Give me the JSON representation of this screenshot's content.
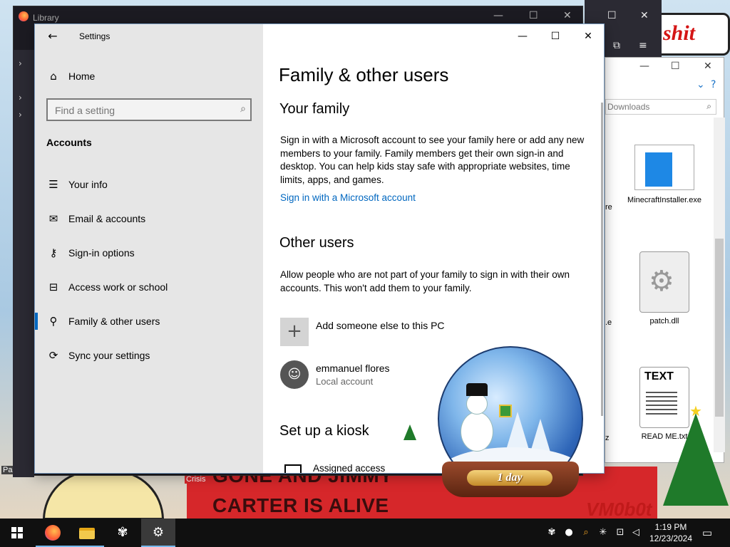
{
  "background": {
    "library_title": "Library",
    "explorer_search_placeholder": "Downloads",
    "explorer_files": [
      {
        "name": "MinecraftInstaller.exe",
        "icon": "exe-icon"
      },
      {
        "name": "patch.dll",
        "icon": "dll-icon"
      },
      {
        "name": "READ ME.txt",
        "icon": "txt-icon",
        "icon_text": "TEXT"
      }
    ],
    "explorer_partial_labels": [
      "re",
      ".e",
      "z"
    ],
    "wall_sign_text": "shit",
    "banner_lines": [
      "GONE AND JIMMY",
      "CARTER IS ALIVE"
    ],
    "crisis_label": "Crisis",
    "papers_label": "Papers, P",
    "vm_tag": "VM0b0t",
    "snowglobe_label": "1 day"
  },
  "settings": {
    "app_title": "Settings",
    "home_label": "Home",
    "search_placeholder": "Find a setting",
    "section_title": "Accounts",
    "nav_items": [
      {
        "label": "Your info",
        "icon": "person-card-icon"
      },
      {
        "label": "Email & accounts",
        "icon": "envelope-icon"
      },
      {
        "label": "Sign-in options",
        "icon": "key-icon"
      },
      {
        "label": "Access work or school",
        "icon": "briefcase-icon"
      },
      {
        "label": "Family & other users",
        "icon": "person-add-icon",
        "active": true
      },
      {
        "label": "Sync your settings",
        "icon": "sync-icon"
      }
    ],
    "page_title": "Family & other users",
    "family_heading": "Your family",
    "family_text": "Sign in with a Microsoft account to see your family here or add any new members to your family. Family members get their own sign-in and desktop. You can help kids stay safe with appropriate websites, time limits, apps, and games.",
    "family_link": "Sign in with a Microsoft account",
    "other_heading": "Other users",
    "other_text": "Allow people who are not part of your family to sign in with their own accounts. This won't add them to your family.",
    "add_user_label": "Add someone else to this PC",
    "user": {
      "name": "emmanuel flores",
      "type": "Local account"
    },
    "kiosk_heading": "Set up a kiosk",
    "assigned_access_label": "Assigned access"
  },
  "taskbar": {
    "time": "1:19 PM",
    "date": "12/23/2024",
    "accent_color": "#76b9ed"
  },
  "colors": {
    "link": "#0067c0",
    "nav_bg": "#e6e6e6",
    "active_indicator": "#0067c0"
  }
}
